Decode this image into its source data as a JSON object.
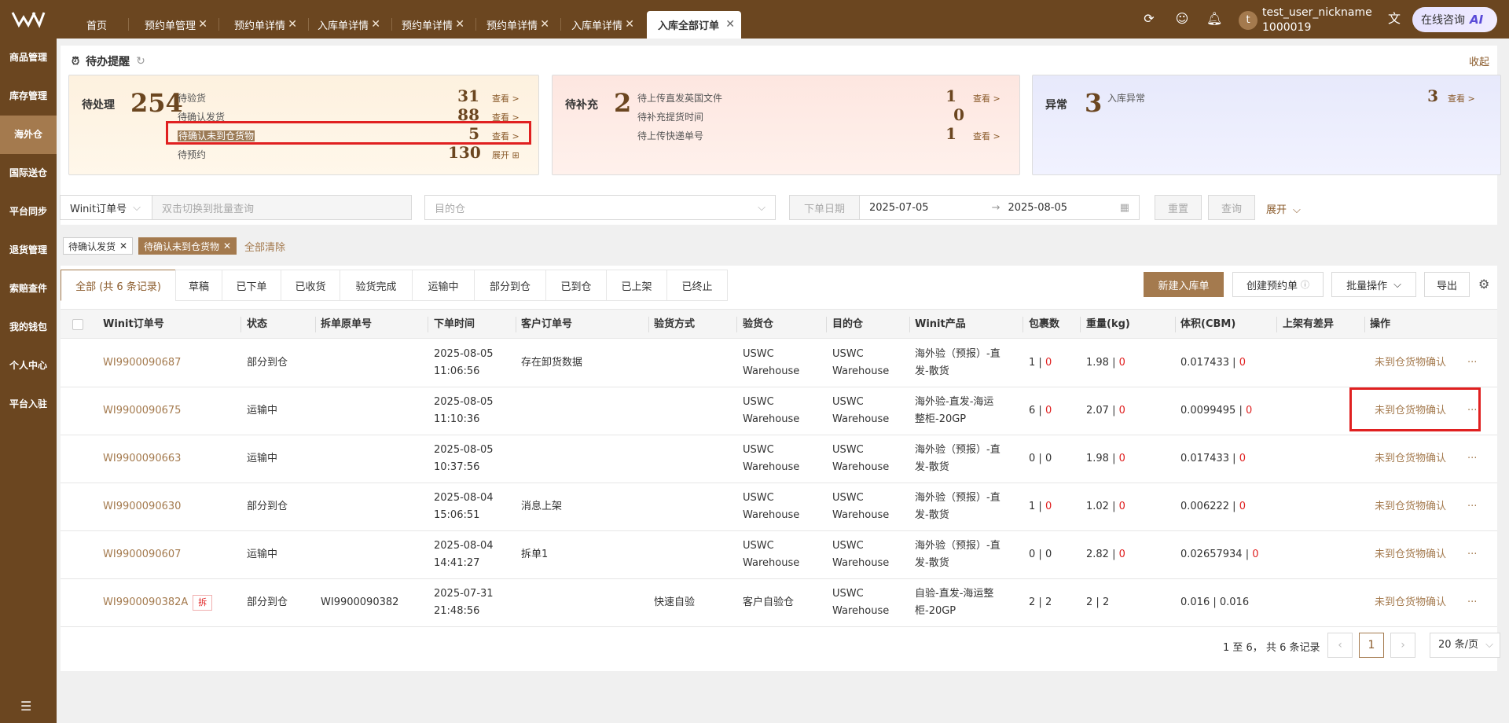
{
  "topbar": {
    "tabs": [
      {
        "label": "首页"
      },
      {
        "label": "预约单管理"
      },
      {
        "label": "预约单详情"
      },
      {
        "label": "入库单详情"
      },
      {
        "label": "预约单详情"
      },
      {
        "label": "预约单详情"
      },
      {
        "label": "入库单详情"
      },
      {
        "label": "入库全部订单"
      }
    ],
    "user_name": "test_user_nickname",
    "user_id": "1000019",
    "avatar_letter": "t",
    "consult_label": "在线咨询",
    "consult_ai": "AI"
  },
  "sidebar": {
    "items": [
      {
        "label": "商品管理"
      },
      {
        "label": "库存管理"
      },
      {
        "label": "海外仓"
      },
      {
        "label": "国际送仓"
      },
      {
        "label": "平台同步"
      },
      {
        "label": "退货管理"
      },
      {
        "label": "索赔查件"
      },
      {
        "label": "我的钱包"
      },
      {
        "label": "个人中心"
      },
      {
        "label": "平台入驻"
      }
    ],
    "active_index": 2
  },
  "reminder": {
    "title": "待办提醒",
    "collapse_label": "收起",
    "pending": {
      "head": "待处理",
      "total": "254",
      "rows": [
        {
          "label": "待验货",
          "count": "31",
          "link": "查看 >"
        },
        {
          "label": "待确认发货",
          "count": "88",
          "link": "查看 >"
        },
        {
          "label": "待确认未到仓货物",
          "count": "5",
          "link": "查看 >"
        },
        {
          "label": "待预约",
          "count": "130",
          "link": "展开 ⊞"
        }
      ]
    },
    "supplement": {
      "head": "待补充",
      "total": "2",
      "rows": [
        {
          "label": "待上传直发英国文件",
          "count": "1",
          "link": "查看 >"
        },
        {
          "label": "待补充提货时间",
          "count": "0",
          "link": ""
        },
        {
          "label": "待上传快递单号",
          "count": "1",
          "link": "查看 >"
        }
      ]
    },
    "abnormal": {
      "head": "异常",
      "total": "3",
      "rows": [
        {
          "label": "入库异常",
          "count": "3",
          "link": "查看 >"
        }
      ]
    }
  },
  "filters": {
    "order_type": "Winit订单号",
    "batch_placeholder": "双击切换到批量查询",
    "dest_placeholder": "目的仓",
    "date_label": "下单日期",
    "date_from": "2025-07-05",
    "date_to": "2025-08-05",
    "reset_label": "重置",
    "query_label": "查询",
    "expand_label": "展开"
  },
  "chips": {
    "items": [
      "待确认发货",
      "待确认未到仓货物"
    ],
    "clear_all": "全部清除"
  },
  "status_tabs": [
    {
      "label": "全部 (共 6 条记录)"
    },
    {
      "label": "草稿"
    },
    {
      "label": "已下单"
    },
    {
      "label": "已收货"
    },
    {
      "label": "验货完成"
    },
    {
      "label": "运输中"
    },
    {
      "label": "部分到仓"
    },
    {
      "label": "已到仓"
    },
    {
      "label": "已上架"
    },
    {
      "label": "已终止"
    }
  ],
  "actions": {
    "new_label": "新建入库单",
    "create_appt_label": "创建预约单",
    "batch_label": "批量操作",
    "export_label": "导出"
  },
  "table": {
    "headers": [
      "Winit订单号",
      "状态",
      "拆单原单号",
      "下单时间",
      "客户订单号",
      "验货方式",
      "验货仓",
      "目的仓",
      "Winit产品",
      "包裹数",
      "重量(kg)",
      "体积(CBM)",
      "上架有差异",
      "操作"
    ],
    "rows": [
      {
        "order": "WI9900090687",
        "split": "",
        "status": "部分到仓",
        "orig": "",
        "date": "2025-08-05",
        "time": "11:06:56",
        "cust": "存在卸货数据",
        "method": "",
        "inspect1": "USWC",
        "inspect2": "Warehouse",
        "dest1": "USWC",
        "dest2": "Warehouse",
        "prod1": "海外验（预报）-直",
        "prod2": "发-散货",
        "pkg_a": "1",
        "pkg_b": "0",
        "wt_a": "1.98",
        "wt_b": "0",
        "vol_a": "0.017433",
        "vol_b": "0",
        "op": "未到仓货物确认",
        "more": "···"
      },
      {
        "order": "WI9900090675",
        "split": "",
        "status": "运输中",
        "orig": "",
        "date": "2025-08-05",
        "time": "11:10:36",
        "cust": "",
        "method": "",
        "inspect1": "USWC",
        "inspect2": "Warehouse",
        "dest1": "USWC",
        "dest2": "Warehouse",
        "prod1": "海外验-直发-海运",
        "prod2": "整柜-20GP",
        "pkg_a": "6",
        "pkg_b": "0",
        "wt_a": "2.07",
        "wt_b": "0",
        "vol_a": "0.0099495",
        "vol_b": "0",
        "op": "未到仓货物确认",
        "more": "···"
      },
      {
        "order": "WI9900090663",
        "split": "",
        "status": "运输中",
        "orig": "",
        "date": "2025-08-05",
        "time": "10:37:56",
        "cust": "",
        "method": "",
        "inspect1": "USWC",
        "inspect2": "Warehouse",
        "dest1": "USWC",
        "dest2": "Warehouse",
        "prod1": "海外验（预报）-直",
        "prod2": "发-散货",
        "pkg_a": "0",
        "pkg_b": "0",
        "wt_a": "1.98",
        "wt_b": "0",
        "vol_a": "0.017433",
        "vol_b": "0",
        "op": "未到仓货物确认",
        "more": "···"
      },
      {
        "order": "WI9900090630",
        "split": "",
        "status": "部分到仓",
        "orig": "",
        "date": "2025-08-04",
        "time": "15:06:51",
        "cust": "消息上架",
        "method": "",
        "inspect1": "USWC",
        "inspect2": "Warehouse",
        "dest1": "USWC",
        "dest2": "Warehouse",
        "prod1": "海外验（预报）-直",
        "prod2": "发-散货",
        "pkg_a": "1",
        "pkg_b": "0",
        "wt_a": "1.02",
        "wt_b": "0",
        "vol_a": "0.006222",
        "vol_b": "0",
        "op": "未到仓货物确认",
        "more": "···"
      },
      {
        "order": "WI9900090607",
        "split": "",
        "status": "运输中",
        "orig": "",
        "date": "2025-08-04",
        "time": "14:41:27",
        "cust": "拆单1",
        "method": "",
        "inspect1": "USWC",
        "inspect2": "Warehouse",
        "dest1": "USWC",
        "dest2": "Warehouse",
        "prod1": "海外验（预报）-直",
        "prod2": "发-散货",
        "pkg_a": "0",
        "pkg_b": "0",
        "wt_a": "2.82",
        "wt_b": "0",
        "vol_a": "0.02657934",
        "vol_b": "0",
        "op": "未到仓货物确认",
        "more": "···"
      },
      {
        "order": "WI9900090382A",
        "split": "拆",
        "status": "部分到仓",
        "orig": "WI9900090382",
        "date": "2025-07-31",
        "time": "21:48:56",
        "cust": "",
        "method": "快速自验",
        "inspect1": "客户自验仓",
        "inspect2": "",
        "dest1": "USWC",
        "dest2": "Warehouse",
        "prod1": "自验-直发-海运整",
        "prod2": "柜-20GP",
        "pkg_a": "2",
        "pkg_b": "2",
        "wt_a": "2",
        "wt_b": "2",
        "vol_a": "0.016",
        "vol_b": "0.016",
        "op": "未到仓货物确认",
        "more": "···"
      }
    ]
  },
  "pagination": {
    "total_text": "1 至 6， 共 6 条记录",
    "current": "1",
    "page_size": "20 条/页"
  }
}
